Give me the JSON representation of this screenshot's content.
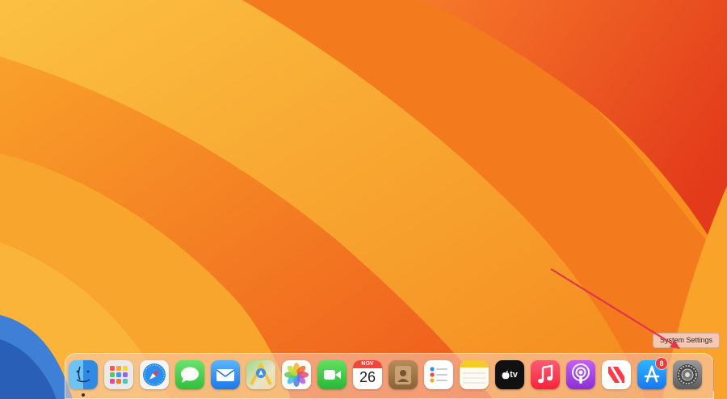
{
  "desktop": {
    "wallpaper": "macOS Ventura orange wallpaper"
  },
  "dock": {
    "apps": [
      {
        "name": "Finder",
        "icon": "finder-icon",
        "running": true
      },
      {
        "name": "Launchpad",
        "icon": "launchpad-icon"
      },
      {
        "name": "Safari",
        "icon": "safari-icon"
      },
      {
        "name": "Messages",
        "icon": "messages-icon"
      },
      {
        "name": "Mail",
        "icon": "mail-icon"
      },
      {
        "name": "Maps",
        "icon": "maps-icon"
      },
      {
        "name": "Photos",
        "icon": "photos-icon"
      },
      {
        "name": "FaceTime",
        "icon": "facetime-icon"
      },
      {
        "name": "Calendar",
        "icon": "calendar-icon",
        "month": "NOV",
        "day": "26"
      },
      {
        "name": "Contacts",
        "icon": "contacts-icon"
      },
      {
        "name": "Reminders",
        "icon": "reminders-icon"
      },
      {
        "name": "Notes",
        "icon": "notes-icon"
      },
      {
        "name": "TV",
        "icon": "apple-tv-icon",
        "label": "tv"
      },
      {
        "name": "Music",
        "icon": "music-icon"
      },
      {
        "name": "Podcasts",
        "icon": "podcasts-icon"
      },
      {
        "name": "News",
        "icon": "news-icon"
      },
      {
        "name": "App Store",
        "icon": "app-store-icon",
        "badge": "8"
      },
      {
        "name": "System Settings",
        "icon": "gear-icon"
      }
    ],
    "tooltip": "System Settings"
  },
  "annotation": {
    "color": "#e0354a"
  },
  "colors": {
    "badge": "#f03a3a",
    "dock_tint": "#f6cdbe"
  }
}
